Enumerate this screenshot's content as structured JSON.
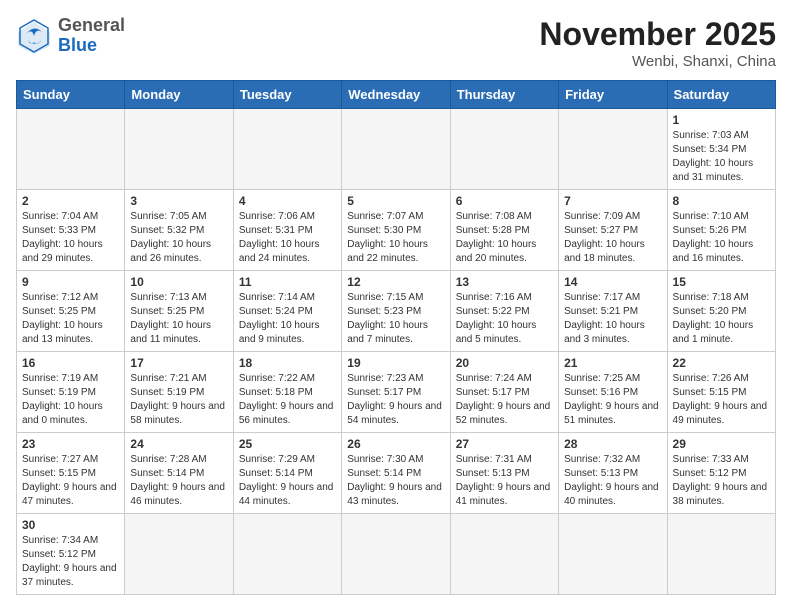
{
  "header": {
    "logo_general": "General",
    "logo_blue": "Blue",
    "month_title": "November 2025",
    "subtitle": "Wenbi, Shanxi, China"
  },
  "weekdays": [
    "Sunday",
    "Monday",
    "Tuesday",
    "Wednesday",
    "Thursday",
    "Friday",
    "Saturday"
  ],
  "weeks": [
    [
      {
        "day": "",
        "empty": true
      },
      {
        "day": "",
        "empty": true
      },
      {
        "day": "",
        "empty": true
      },
      {
        "day": "",
        "empty": true
      },
      {
        "day": "",
        "empty": true
      },
      {
        "day": "",
        "empty": true
      },
      {
        "day": "1",
        "sunrise": "Sunrise: 7:03 AM",
        "sunset": "Sunset: 5:34 PM",
        "daylight": "Daylight: 10 hours and 31 minutes."
      }
    ],
    [
      {
        "day": "2",
        "sunrise": "Sunrise: 7:04 AM",
        "sunset": "Sunset: 5:33 PM",
        "daylight": "Daylight: 10 hours and 29 minutes."
      },
      {
        "day": "3",
        "sunrise": "Sunrise: 7:05 AM",
        "sunset": "Sunset: 5:32 PM",
        "daylight": "Daylight: 10 hours and 26 minutes."
      },
      {
        "day": "4",
        "sunrise": "Sunrise: 7:06 AM",
        "sunset": "Sunset: 5:31 PM",
        "daylight": "Daylight: 10 hours and 24 minutes."
      },
      {
        "day": "5",
        "sunrise": "Sunrise: 7:07 AM",
        "sunset": "Sunset: 5:30 PM",
        "daylight": "Daylight: 10 hours and 22 minutes."
      },
      {
        "day": "6",
        "sunrise": "Sunrise: 7:08 AM",
        "sunset": "Sunset: 5:28 PM",
        "daylight": "Daylight: 10 hours and 20 minutes."
      },
      {
        "day": "7",
        "sunrise": "Sunrise: 7:09 AM",
        "sunset": "Sunset: 5:27 PM",
        "daylight": "Daylight: 10 hours and 18 minutes."
      },
      {
        "day": "8",
        "sunrise": "Sunrise: 7:10 AM",
        "sunset": "Sunset: 5:26 PM",
        "daylight": "Daylight: 10 hours and 16 minutes."
      }
    ],
    [
      {
        "day": "9",
        "sunrise": "Sunrise: 7:12 AM",
        "sunset": "Sunset: 5:25 PM",
        "daylight": "Daylight: 10 hours and 13 minutes."
      },
      {
        "day": "10",
        "sunrise": "Sunrise: 7:13 AM",
        "sunset": "Sunset: 5:25 PM",
        "daylight": "Daylight: 10 hours and 11 minutes."
      },
      {
        "day": "11",
        "sunrise": "Sunrise: 7:14 AM",
        "sunset": "Sunset: 5:24 PM",
        "daylight": "Daylight: 10 hours and 9 minutes."
      },
      {
        "day": "12",
        "sunrise": "Sunrise: 7:15 AM",
        "sunset": "Sunset: 5:23 PM",
        "daylight": "Daylight: 10 hours and 7 minutes."
      },
      {
        "day": "13",
        "sunrise": "Sunrise: 7:16 AM",
        "sunset": "Sunset: 5:22 PM",
        "daylight": "Daylight: 10 hours and 5 minutes."
      },
      {
        "day": "14",
        "sunrise": "Sunrise: 7:17 AM",
        "sunset": "Sunset: 5:21 PM",
        "daylight": "Daylight: 10 hours and 3 minutes."
      },
      {
        "day": "15",
        "sunrise": "Sunrise: 7:18 AM",
        "sunset": "Sunset: 5:20 PM",
        "daylight": "Daylight: 10 hours and 1 minute."
      }
    ],
    [
      {
        "day": "16",
        "sunrise": "Sunrise: 7:19 AM",
        "sunset": "Sunset: 5:19 PM",
        "daylight": "Daylight: 10 hours and 0 minutes."
      },
      {
        "day": "17",
        "sunrise": "Sunrise: 7:21 AM",
        "sunset": "Sunset: 5:19 PM",
        "daylight": "Daylight: 9 hours and 58 minutes."
      },
      {
        "day": "18",
        "sunrise": "Sunrise: 7:22 AM",
        "sunset": "Sunset: 5:18 PM",
        "daylight": "Daylight: 9 hours and 56 minutes."
      },
      {
        "day": "19",
        "sunrise": "Sunrise: 7:23 AM",
        "sunset": "Sunset: 5:17 PM",
        "daylight": "Daylight: 9 hours and 54 minutes."
      },
      {
        "day": "20",
        "sunrise": "Sunrise: 7:24 AM",
        "sunset": "Sunset: 5:17 PM",
        "daylight": "Daylight: 9 hours and 52 minutes."
      },
      {
        "day": "21",
        "sunrise": "Sunrise: 7:25 AM",
        "sunset": "Sunset: 5:16 PM",
        "daylight": "Daylight: 9 hours and 51 minutes."
      },
      {
        "day": "22",
        "sunrise": "Sunrise: 7:26 AM",
        "sunset": "Sunset: 5:15 PM",
        "daylight": "Daylight: 9 hours and 49 minutes."
      }
    ],
    [
      {
        "day": "23",
        "sunrise": "Sunrise: 7:27 AM",
        "sunset": "Sunset: 5:15 PM",
        "daylight": "Daylight: 9 hours and 47 minutes."
      },
      {
        "day": "24",
        "sunrise": "Sunrise: 7:28 AM",
        "sunset": "Sunset: 5:14 PM",
        "daylight": "Daylight: 9 hours and 46 minutes."
      },
      {
        "day": "25",
        "sunrise": "Sunrise: 7:29 AM",
        "sunset": "Sunset: 5:14 PM",
        "daylight": "Daylight: 9 hours and 44 minutes."
      },
      {
        "day": "26",
        "sunrise": "Sunrise: 7:30 AM",
        "sunset": "Sunset: 5:14 PM",
        "daylight": "Daylight: 9 hours and 43 minutes."
      },
      {
        "day": "27",
        "sunrise": "Sunrise: 7:31 AM",
        "sunset": "Sunset: 5:13 PM",
        "daylight": "Daylight: 9 hours and 41 minutes."
      },
      {
        "day": "28",
        "sunrise": "Sunrise: 7:32 AM",
        "sunset": "Sunset: 5:13 PM",
        "daylight": "Daylight: 9 hours and 40 minutes."
      },
      {
        "day": "29",
        "sunrise": "Sunrise: 7:33 AM",
        "sunset": "Sunset: 5:12 PM",
        "daylight": "Daylight: 9 hours and 38 minutes."
      }
    ],
    [
      {
        "day": "30",
        "sunrise": "Sunrise: 7:34 AM",
        "sunset": "Sunset: 5:12 PM",
        "daylight": "Daylight: 9 hours and 37 minutes."
      },
      {
        "day": "",
        "empty": true
      },
      {
        "day": "",
        "empty": true
      },
      {
        "day": "",
        "empty": true
      },
      {
        "day": "",
        "empty": true
      },
      {
        "day": "",
        "empty": true
      },
      {
        "day": "",
        "empty": true
      }
    ]
  ]
}
